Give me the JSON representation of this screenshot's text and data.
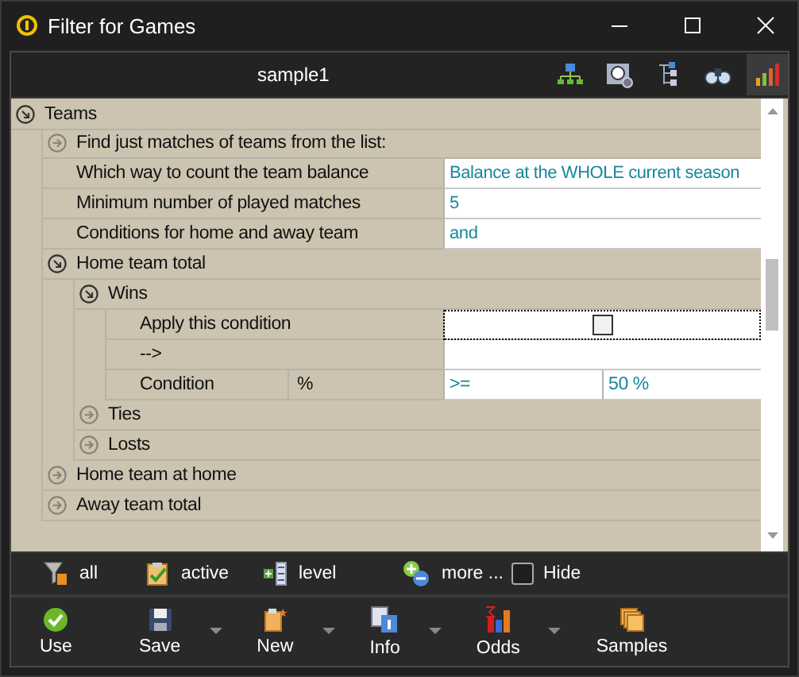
{
  "window": {
    "title": "Filter for Games"
  },
  "header": {
    "title": "sample1",
    "view_buttons": [
      {
        "selected": false
      },
      {
        "selected": false
      },
      {
        "selected": false
      },
      {
        "selected": false
      },
      {
        "selected": true
      }
    ]
  },
  "tree": [
    {
      "kind": "group",
      "label": "Teams",
      "expanded": true,
      "children": [
        {
          "kind": "group",
          "label": "Find just matches of teams from the list:",
          "expanded": false
        },
        {
          "kind": "property",
          "label": "Which way to count the team balance",
          "value": "Balance at the WHOLE current season"
        },
        {
          "kind": "property",
          "label": "Minimum number of played matches",
          "value": "5"
        },
        {
          "kind": "property",
          "label": "Conditions for home and away team",
          "value": "and"
        },
        {
          "kind": "group",
          "label": "Home team total",
          "expanded": true,
          "children": [
            {
              "kind": "group",
              "label": "Wins",
              "expanded": true,
              "children": [
                {
                  "kind": "checkbox",
                  "label": "Apply this condition",
                  "checked": false,
                  "focused": true
                },
                {
                  "kind": "property",
                  "label": "-->"
                },
                {
                  "kind": "condition",
                  "label": "Condition",
                  "unit": "%",
                  "operator": ">=",
                  "value": "50 %"
                }
              ]
            },
            {
              "kind": "group",
              "label": "Ties",
              "expanded": false
            },
            {
              "kind": "group",
              "label": "Losts",
              "expanded": false
            }
          ]
        },
        {
          "kind": "group",
          "label": "Home team at home",
          "expanded": false
        },
        {
          "kind": "group",
          "label": "Away team total",
          "expanded": false
        }
      ]
    }
  ],
  "filter_bar": {
    "items": [
      {
        "label": "all"
      },
      {
        "label": "active"
      },
      {
        "label": "level"
      },
      {
        "label": "more ..."
      }
    ],
    "hide": {
      "label": "Hide",
      "checked": false
    }
  },
  "toolbar": [
    {
      "label": "Use",
      "dropdown": false
    },
    {
      "label": "Save",
      "dropdown": true
    },
    {
      "label": "New",
      "dropdown": true
    },
    {
      "label": "Info",
      "dropdown": true
    },
    {
      "label": "Odds",
      "dropdown": true
    },
    {
      "label": "Samples",
      "dropdown": false
    }
  ]
}
